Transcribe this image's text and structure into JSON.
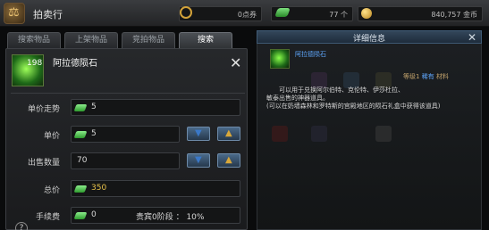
{
  "app": {
    "title": "拍卖行"
  },
  "currency": {
    "points": "0点券",
    "gems": "77 个",
    "gold": "840,757 金币"
  },
  "tabs": [
    {
      "label": "搜索物品",
      "active": false
    },
    {
      "label": "上架物品",
      "active": false
    },
    {
      "label": "竞拍物品",
      "active": false
    },
    {
      "label": "搜索",
      "active": true
    }
  ],
  "listing": {
    "item_name": "阿拉德陨石",
    "item_count": "198",
    "close_symbol": "✕",
    "unit_trend_label": "单价走势",
    "unit_trend_value": "5",
    "unit_price_label": "单价",
    "unit_price_value": "5",
    "quantity_label": "出售数量",
    "quantity_value": "70",
    "total_label": "总价",
    "total_value": "350",
    "fee_label": "手续费",
    "fee_value": "0",
    "fee_tier": "贵宾0阶段 ： 10%",
    "help_symbol": "?"
  },
  "details": {
    "title": "详细信息",
    "close_symbol": "✕",
    "item_name": "阿拉德陨石",
    "level_prefix": "等级1",
    "level_rarity": "稀有",
    "level_type": "材料",
    "description": [
      "可以用于兑换阿尔伯特、克伦特、伊莎杜拉、",
      "敏泰出售的神器道具。",
      "(可以在奶墙森林和罗特斯的宫殿地区的陨石礼盒中获得该道具)"
    ]
  },
  "colors": {
    "accent_blue": "#5fa8ff",
    "total_gold": "#e8c24a",
    "gem_green": "#2d9a2d"
  }
}
